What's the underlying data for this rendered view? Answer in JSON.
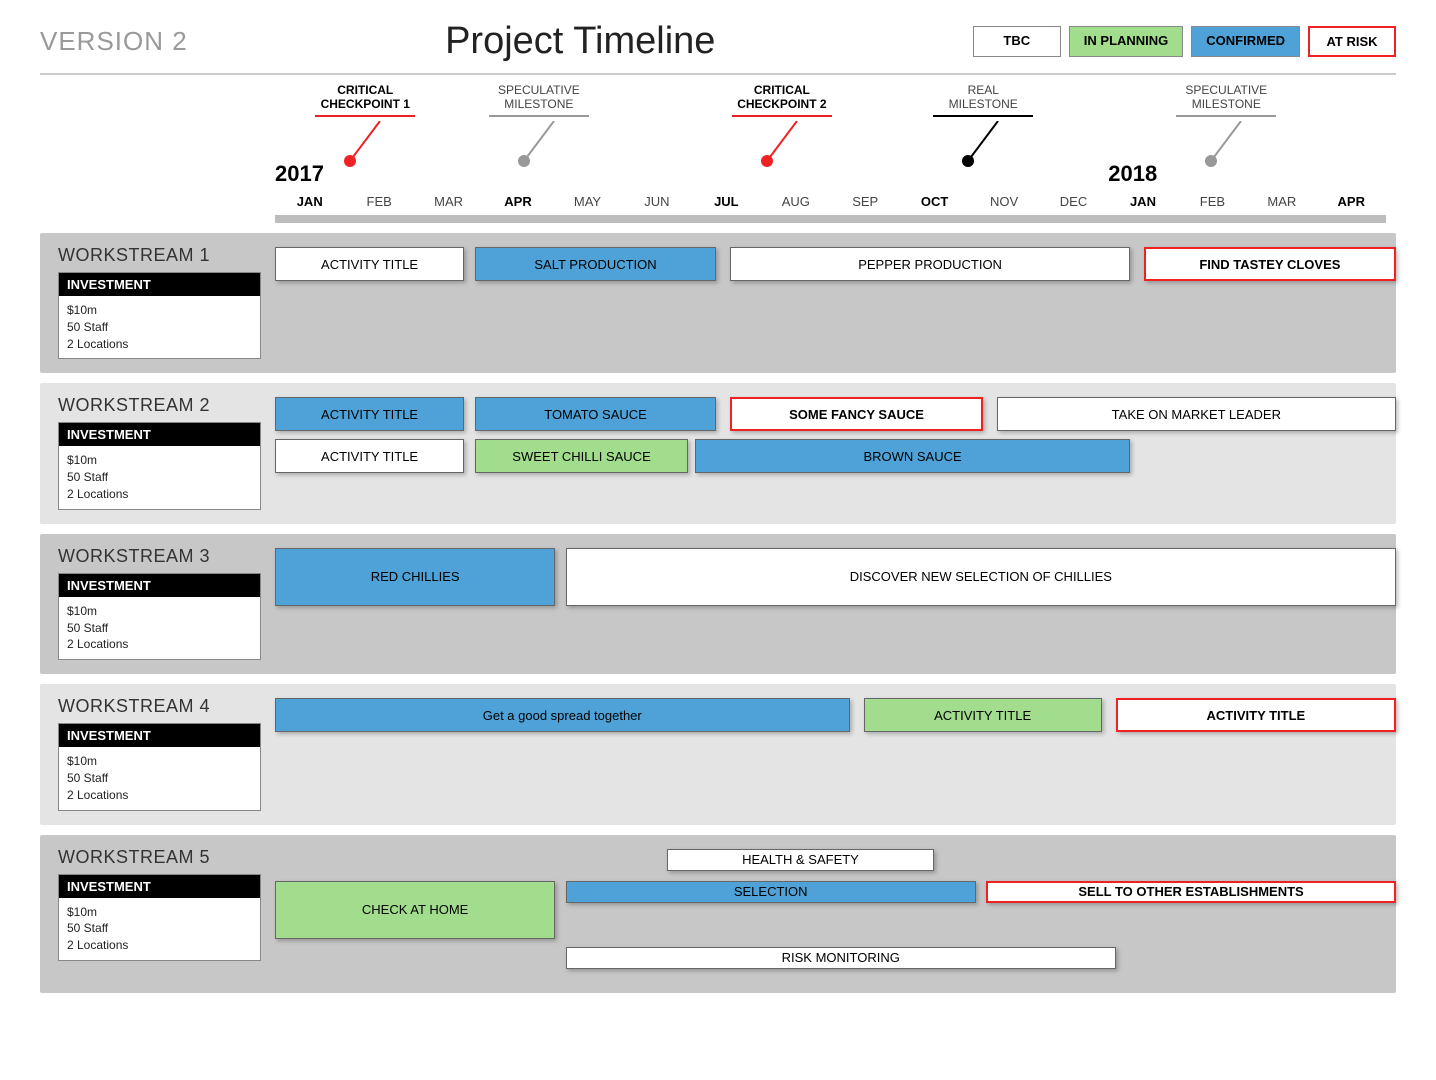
{
  "header": {
    "version": "VERSION 2",
    "title": "Project Timeline",
    "legend": {
      "tbc": "TBC",
      "planning": "IN PLANNING",
      "confirmed": "CONFIRMED",
      "atrisk": "AT RISK"
    }
  },
  "axis": {
    "years": {
      "y2017": "2017",
      "y2018": "2018"
    },
    "months": [
      "JAN",
      "FEB",
      "MAR",
      "APR",
      "MAY",
      "JUN",
      "JUL",
      "AUG",
      "SEP",
      "OCT",
      "NOV",
      "DEC",
      "JAN",
      "FEB",
      "MAR",
      "APR"
    ],
    "bold_indices": [
      0,
      3,
      6,
      9,
      12,
      15
    ],
    "markers": [
      {
        "pos": 1.3,
        "line1": "CRITICAL",
        "line2": "CHECKPOINT 1",
        "color": "red",
        "crit": true
      },
      {
        "pos": 3.8,
        "line1": "SPECULATIVE",
        "line2": "MILESTONE",
        "color": "grey",
        "crit": false
      },
      {
        "pos": 7.3,
        "line1": "CRITICAL",
        "line2": "CHECKPOINT 2",
        "color": "red",
        "crit": true
      },
      {
        "pos": 10.2,
        "line1": "REAL",
        "line2": "MILESTONE",
        "color": "black",
        "crit": false
      },
      {
        "pos": 13.7,
        "line1": "SPECULATIVE",
        "line2": "MILESTONE",
        "color": "grey",
        "crit": false
      }
    ]
  },
  "streams": [
    {
      "title": "WORKSTREAM 1",
      "light": false,
      "investment": {
        "h": "INVESTMENT",
        "lines": [
          "$10m",
          "50 Staff",
          "2 Locations"
        ]
      },
      "rows": [
        [
          {
            "label": "ACTIVITY TITLE",
            "start": 0,
            "end": 2.7,
            "style": "white"
          },
          {
            "label": "SALT PRODUCTION",
            "start": 2.85,
            "end": 6.3,
            "style": "blue"
          },
          {
            "label": "PEPPER PRODUCTION",
            "start": 6.5,
            "end": 12.2,
            "style": "white"
          },
          {
            "label": "FIND TASTEY CLOVES",
            "start": 12.4,
            "end": 16,
            "style": "risk"
          }
        ]
      ]
    },
    {
      "title": "WORKSTREAM 2",
      "light": true,
      "investment": {
        "h": "INVESTMENT",
        "lines": [
          "$10m",
          "50 Staff",
          "2 Locations"
        ]
      },
      "rows": [
        [
          {
            "label": "ACTIVITY TITLE",
            "start": 0,
            "end": 2.7,
            "style": "blue"
          },
          {
            "label": "TOMATO SAUCE",
            "start": 2.85,
            "end": 6.3,
            "style": "blue"
          },
          {
            "label": "SOME FANCY SAUCE",
            "start": 6.5,
            "end": 10.1,
            "style": "risk"
          },
          {
            "label": "TAKE ON MARKET LEADER",
            "start": 10.3,
            "end": 16,
            "style": "white"
          }
        ],
        [
          {
            "label": "ACTIVITY TITLE",
            "start": 0,
            "end": 2.7,
            "style": "white"
          },
          {
            "label": "SWEET CHILLI SAUCE",
            "start": 2.85,
            "end": 5.9,
            "style": "green"
          },
          {
            "label": "BROWN SAUCE",
            "start": 6.0,
            "end": 12.2,
            "style": "blue"
          }
        ]
      ]
    },
    {
      "title": "WORKSTREAM 3",
      "light": false,
      "investment": {
        "h": "INVESTMENT",
        "lines": [
          "$10m",
          "50 Staff",
          "2 Locations"
        ]
      },
      "rows": [
        [
          {
            "label": "RED CHILLIES",
            "start": 0,
            "end": 4.0,
            "style": "blue",
            "tall": true
          },
          {
            "label": "DISCOVER NEW SELECTION OF CHILLIES",
            "start": 4.15,
            "end": 16,
            "style": "white",
            "tall": true
          }
        ]
      ]
    },
    {
      "title": "WORKSTREAM 4",
      "light": true,
      "investment": {
        "h": "INVESTMENT",
        "lines": [
          "$10m",
          "50 Staff",
          "2 Locations"
        ]
      },
      "rows": [
        [
          {
            "label": "Get a good spread together",
            "start": 0,
            "end": 8.2,
            "style": "blue"
          },
          {
            "label": "ACTIVITY TITLE",
            "start": 8.4,
            "end": 11.8,
            "style": "green"
          },
          {
            "label": "ACTIVITY TITLE",
            "start": 12.0,
            "end": 16,
            "style": "risk"
          }
        ]
      ]
    },
    {
      "title": "WORKSTREAM 5",
      "light": false,
      "investment": {
        "h": "INVESTMENT",
        "lines": [
          "$10m",
          "50 Staff",
          "2 Locations"
        ]
      },
      "rows": [
        [
          {
            "label": "HEALTH & SAFETY",
            "start": 5.6,
            "end": 9.4,
            "style": "white",
            "thin": true
          }
        ],
        [
          {
            "label": "CHECK AT HOME",
            "start": 0,
            "end": 4.0,
            "style": "green",
            "tall": true
          },
          {
            "label": "SELECTION",
            "start": 4.15,
            "end": 10.0,
            "style": "blue",
            "thin": true
          },
          {
            "label": "SELL TO OTHER ESTABLISHMENTS",
            "start": 10.15,
            "end": 16,
            "style": "risk",
            "thin": true
          }
        ],
        [
          {
            "label": "RISK MONITORING",
            "start": 4.15,
            "end": 12.0,
            "style": "white",
            "thin": true
          }
        ]
      ]
    }
  ]
}
